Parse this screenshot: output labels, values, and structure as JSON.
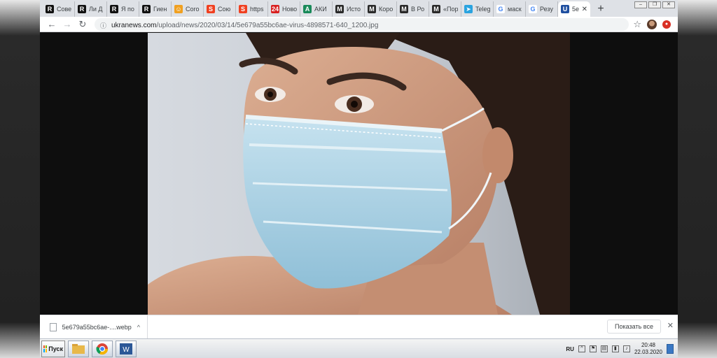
{
  "tabs": [
    {
      "label": "Сове",
      "icon": "r-icon",
      "color": "#111111"
    },
    {
      "label": "Ли Д",
      "icon": "r-icon",
      "color": "#111111"
    },
    {
      "label": "Я по",
      "icon": "r-icon",
      "color": "#111111"
    },
    {
      "label": "Гиен",
      "icon": "r-icon",
      "color": "#111111"
    },
    {
      "label": "Coro",
      "icon": "face-icon",
      "color": "#f0a020"
    },
    {
      "label": "Сою",
      "icon": "s-icon",
      "color": "#f04020"
    },
    {
      "label": "https",
      "icon": "s-icon",
      "color": "#f04020"
    },
    {
      "label": "Ново",
      "icon": "24-icon",
      "color": "#d82020"
    },
    {
      "label": "АКИ",
      "icon": "a-icon",
      "color": "#1a8a5a"
    },
    {
      "label": "Исто",
      "icon": "m-icon",
      "color": "#2a2a2a"
    },
    {
      "label": "Коро",
      "icon": "m-icon",
      "color": "#2a2a2a"
    },
    {
      "label": "В Ро",
      "icon": "m-icon",
      "color": "#2a2a2a"
    },
    {
      "label": "«Пор",
      "icon": "m-icon",
      "color": "#2a2a2a"
    },
    {
      "label": "Teleg",
      "icon": "telegram-icon",
      "color": "#2aa3df"
    },
    {
      "label": "маск",
      "icon": "google-icon",
      "color": "#4285f4"
    },
    {
      "label": "Резу",
      "icon": "google-icon",
      "color": "#4285f4"
    },
    {
      "label": "5e",
      "icon": "un-icon",
      "color": "#1f4fa0",
      "active": true
    }
  ],
  "tab_glyphs": {
    "r": "R",
    "s": "S",
    "a": "A",
    "m": "M",
    "g": "G",
    "tg": "➤",
    "n24": "24",
    "un": "U"
  },
  "window_controls": {
    "minimize": "‒",
    "restore": "❐",
    "close": "✕"
  },
  "newtab_label": "+",
  "address": {
    "host": "ukranews.com",
    "path": "/upload/news/2020/03/14/5e679a55bc6ae-virus-4898571-640_1200.jpg"
  },
  "nav": {
    "back": "←",
    "forward": "→",
    "reload": "↻",
    "star": "☆"
  },
  "download": {
    "filename": "5e679a55bc6ae-....webp",
    "show_all": "Показать все",
    "close": "✕",
    "chevron": "^"
  },
  "taskbar": {
    "start_label": "Пуск",
    "lang": "RU",
    "time": "20:48",
    "date": "22.03.2020"
  },
  "colors": {
    "tabstrip": "#dee1e6",
    "accent_chrome_red": "#d93025",
    "mask_blue": "#a9cde0",
    "background_page": "#0e0e0e"
  }
}
